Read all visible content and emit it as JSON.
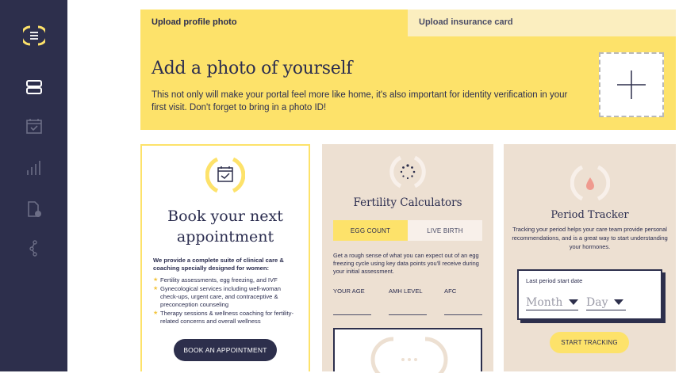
{
  "tabs": {
    "active": "Upload profile photo",
    "inactive": "Upload insurance card"
  },
  "banner": {
    "title": "Add a photo of yourself",
    "body": "This not only will make your portal feel more like home, it's also important for identity verification in your first visit. Don't forget to bring in a photo ID!"
  },
  "appointment": {
    "title": "Book your next appointment",
    "subtitle": "We provide a complete suite of clinical care & coaching specially designed for women:",
    "items": [
      "Fertility assessments, egg freezing, and IVF",
      "Gynecological services including well-woman check-ups, urgent care, and contraceptive & preconception counseling",
      "Therapy sessions & wellness coaching for fertility-related concerns and overall wellness"
    ],
    "button": "BOOK AN APPOINTMENT"
  },
  "fertility": {
    "title": "Fertility Calculators",
    "toggle": [
      "EGG COUNT",
      "LIVE BIRTH"
    ],
    "description": "Get a rough sense of what you can expect out of an egg freezing cycle using key data points you'll receive during your initial assessment.",
    "fields": [
      "YOUR AGE",
      "AMH LEVEL",
      "AFC"
    ]
  },
  "period": {
    "title": "Period Tracker",
    "description": "Tracking your period helps your care team provide personal recommendations, and is a great way to start understanding your hormones.",
    "date_label": "Last period start date",
    "month": "Month",
    "day": "Day",
    "button": "START TRACKING"
  },
  "colors": {
    "sidebar": "#2d2f4c",
    "accent": "#fde26a",
    "card": "#ede0d2"
  }
}
